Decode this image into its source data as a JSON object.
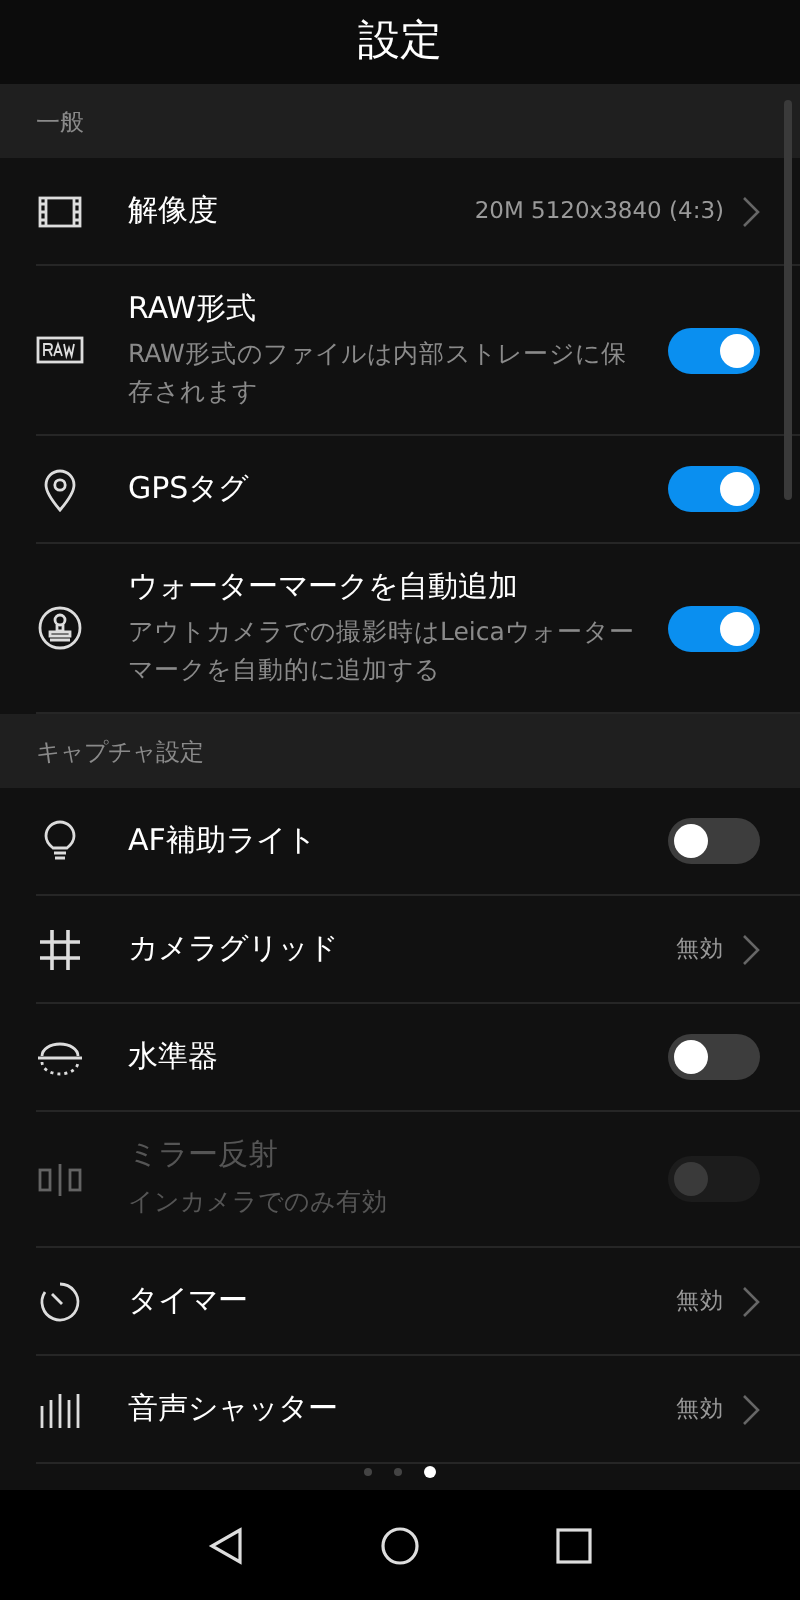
{
  "header": {
    "title": "設定"
  },
  "sections": [
    {
      "title": "一般",
      "items": [
        {
          "kind": "value",
          "label": "解像度",
          "value": "20M 5120x3840 (4:3)",
          "disabled": false
        },
        {
          "kind": "toggle",
          "label": "RAW形式",
          "description": "RAW形式のファイルは内部ストレージに保存されます",
          "on": true,
          "disabled": false
        },
        {
          "kind": "toggle",
          "label": "GPSタグ",
          "on": true,
          "disabled": false
        },
        {
          "kind": "toggle",
          "label": "ウォーターマークを自動追加",
          "description": "アウトカメラでの撮影時はLeicaウォーターマークを自動的に追加する",
          "on": true,
          "disabled": false
        }
      ]
    },
    {
      "title": "キャプチャ設定",
      "items": [
        {
          "kind": "toggle",
          "label": "AF補助ライト",
          "on": false,
          "disabled": false
        },
        {
          "kind": "value",
          "label": "カメラグリッド",
          "value": "無効",
          "disabled": false
        },
        {
          "kind": "toggle",
          "label": "水準器",
          "on": false,
          "disabled": false
        },
        {
          "kind": "toggle",
          "label": "ミラー反射",
          "description": "インカメラでのみ有効",
          "on": false,
          "disabled": true
        },
        {
          "kind": "value",
          "label": "タイマー",
          "value": "無効",
          "disabled": false
        },
        {
          "kind": "value",
          "label": "音声シャッター",
          "value": "無効",
          "disabled": false
        }
      ]
    }
  ],
  "page_dots": [
    {
      "selected": false
    },
    {
      "selected": false
    },
    {
      "selected": true
    }
  ]
}
